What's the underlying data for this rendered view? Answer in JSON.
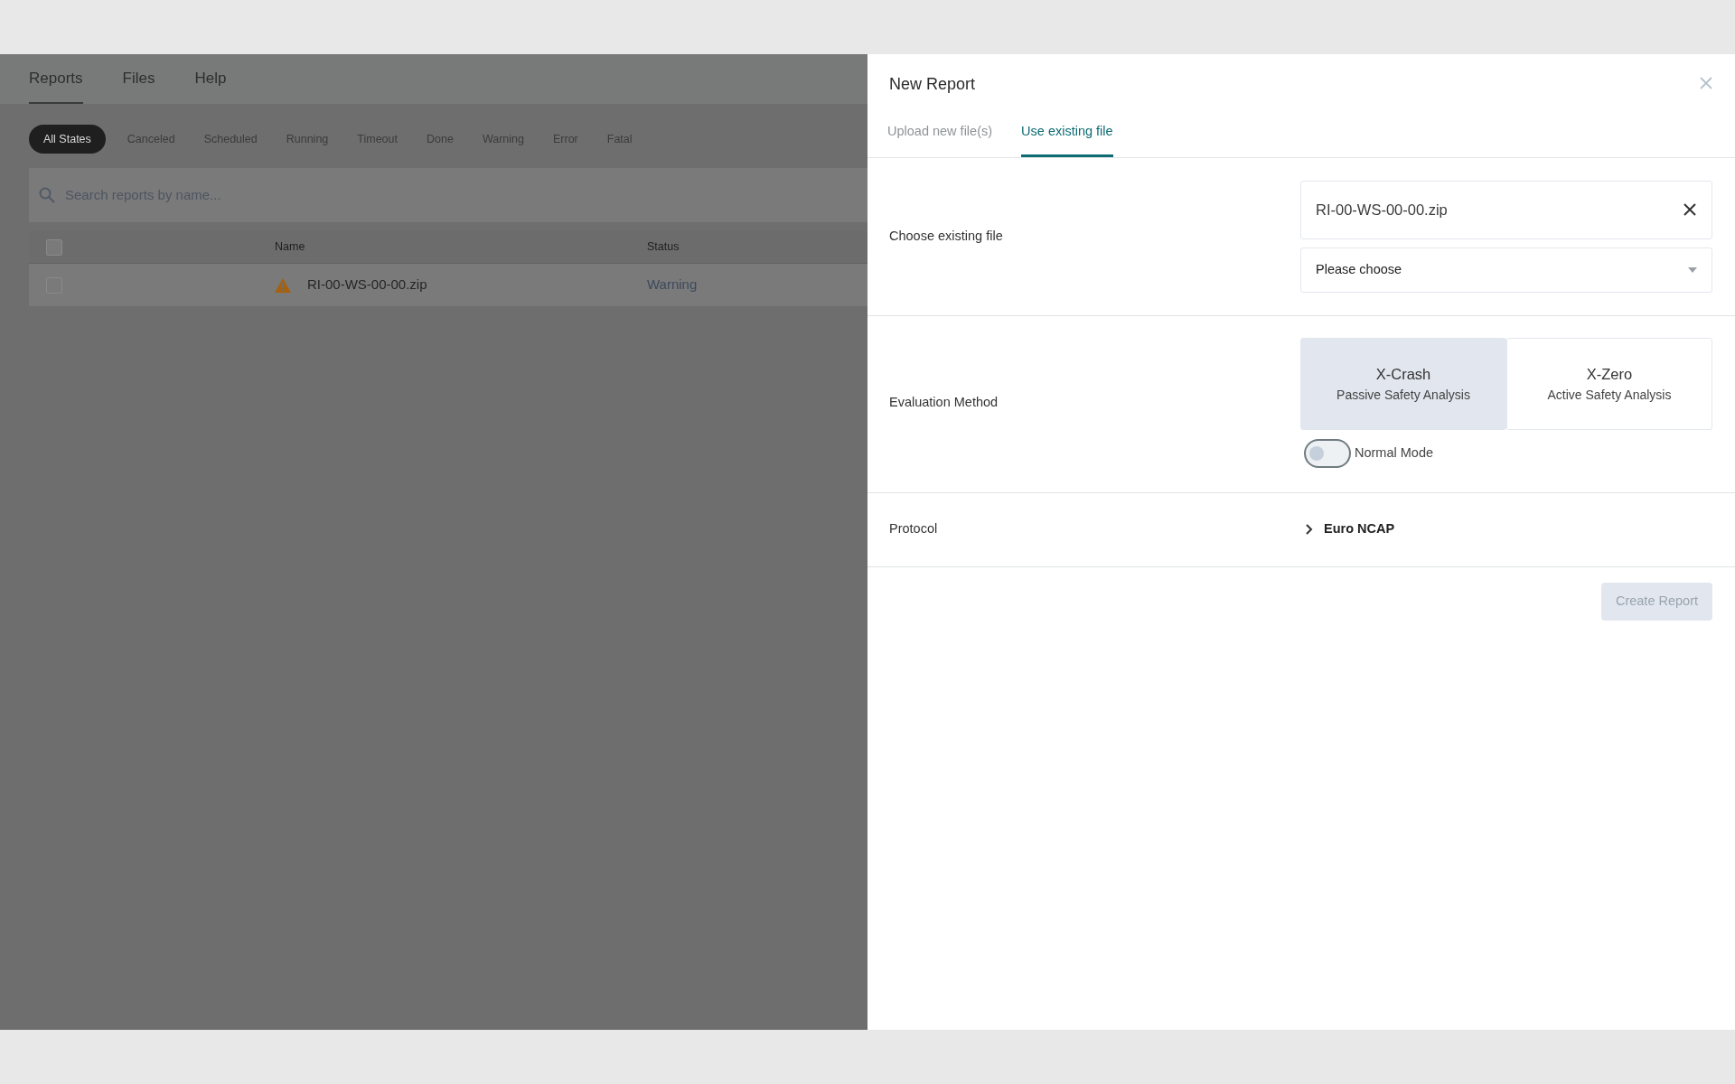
{
  "nav": {
    "items": [
      {
        "label": "Reports",
        "selected": true
      },
      {
        "label": "Files",
        "selected": false
      },
      {
        "label": "Help",
        "selected": false
      }
    ]
  },
  "filters": [
    {
      "label": "All States",
      "selected": true
    },
    {
      "label": "Canceled",
      "selected": false
    },
    {
      "label": "Scheduled",
      "selected": false
    },
    {
      "label": "Running",
      "selected": false
    },
    {
      "label": "Timeout",
      "selected": false
    },
    {
      "label": "Done",
      "selected": false
    },
    {
      "label": "Warning",
      "selected": false
    },
    {
      "label": "Error",
      "selected": false
    },
    {
      "label": "Fatal",
      "selected": false
    }
  ],
  "search": {
    "placeholder": "Search reports by name..."
  },
  "table": {
    "all_checked": false,
    "columns": [
      "Name",
      "Status"
    ],
    "rows": [
      {
        "checked": false,
        "kind": "warning",
        "name": "RI-00-WS-00-00.zip",
        "status": "Warning"
      }
    ]
  },
  "dialog": {
    "title": "New Report",
    "tabs": [
      {
        "label": "Upload new file(s)",
        "selected": false
      },
      {
        "label": "Use existing file",
        "selected": true
      }
    ],
    "file_section": {
      "label": "Choose existing file",
      "file": "RI-00-WS-00-00.zip",
      "select_placeholder": "Please choose"
    },
    "evaluation": {
      "label": "Evaluation Method",
      "options": [
        {
          "name": "X-Crash",
          "description": "Passive Safety Analysis",
          "selected": true
        },
        {
          "name": "X-Zero",
          "description": "Active Safety Analysis",
          "selected": false
        }
      ],
      "mode_toggle": {
        "label": "Normal Mode",
        "on": false
      }
    },
    "protocol": {
      "label": "Protocol",
      "value": "Euro NCAP",
      "expanded": false
    },
    "create_button": {
      "label": "Create Report",
      "disabled": true
    }
  }
}
